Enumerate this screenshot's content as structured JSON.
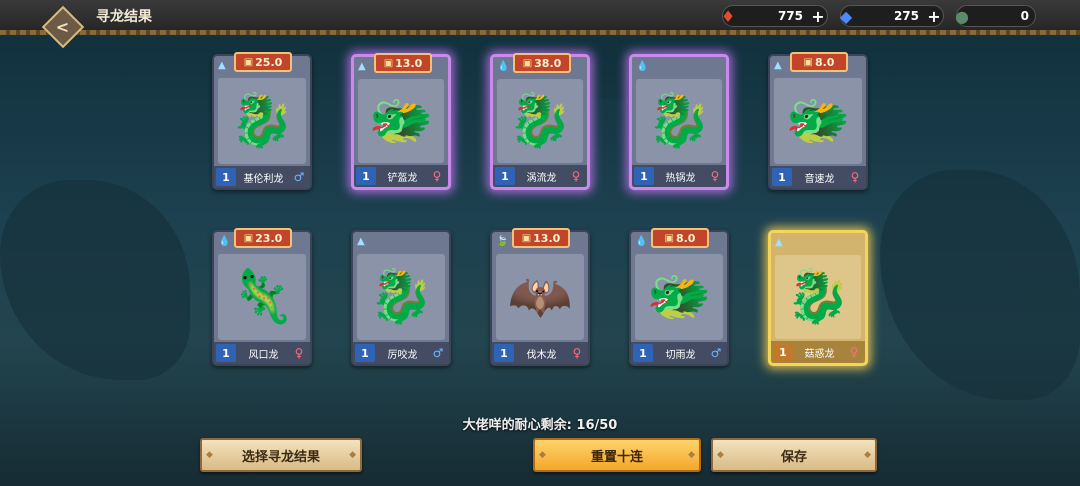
{
  "header": {
    "back_icon": "back-arrow-icon",
    "title": "寻龙结果",
    "resources": [
      {
        "icon": "red-gem-icon",
        "glyph": "♦",
        "color": "#e64a2e",
        "value": "775",
        "plus": "+"
      },
      {
        "icon": "blue-crystal-icon",
        "glyph": "◆",
        "color": "#4a8cff",
        "value": "275",
        "plus": "+"
      },
      {
        "icon": "dragon-egg-icon",
        "glyph": "●",
        "color": "#5a8a6a",
        "value": "0"
      }
    ]
  },
  "cards": [
    {
      "level": "1",
      "name": "基伦利龙",
      "sex": "♂",
      "sex_class": "m",
      "badge": "25.0",
      "badge_icon": "flame-box-icon",
      "element": "▲",
      "rarity": "normal",
      "glyph": "🐉"
    },
    {
      "level": "1",
      "name": "铲盔龙",
      "sex": "♀",
      "sex_class": "f",
      "badge": "13.0",
      "badge_icon": "axe-icon",
      "element": "▲",
      "rarity": "purple",
      "glyph": "🐲"
    },
    {
      "level": "1",
      "name": "涡流龙",
      "sex": "♀",
      "sex_class": "f",
      "badge": "38.0",
      "badge_icon": "flame-box-icon",
      "element": "💧",
      "rarity": "purple",
      "glyph": "🐉"
    },
    {
      "level": "1",
      "name": "热锅龙",
      "sex": "♀",
      "sex_class": "f",
      "badge": "",
      "badge_icon": "",
      "element": "💧",
      "rarity": "purple",
      "glyph": "🐉"
    },
    {
      "level": "1",
      "name": "音速龙",
      "sex": "♀",
      "sex_class": "f",
      "badge": "8.0",
      "badge_icon": "coin-icon",
      "element": "▲",
      "rarity": "normal",
      "glyph": "🐲"
    },
    {
      "level": "1",
      "name": "风口龙",
      "sex": "♀",
      "sex_class": "f",
      "badge": "23.0",
      "badge_icon": "flame-box-icon",
      "element": "💧",
      "rarity": "normal",
      "glyph": "🦎"
    },
    {
      "level": "1",
      "name": "厉咬龙",
      "sex": "♂",
      "sex_class": "m",
      "badge": "",
      "badge_icon": "",
      "element": "▲",
      "rarity": "normal",
      "glyph": "🐉"
    },
    {
      "level": "1",
      "name": "伐木龙",
      "sex": "♀",
      "sex_class": "f",
      "badge": "13.0",
      "badge_icon": "axe-icon",
      "element": "🍃",
      "rarity": "normal",
      "glyph": "🦇"
    },
    {
      "level": "1",
      "name": "切雨龙",
      "sex": "♂",
      "sex_class": "m",
      "badge": "8.0",
      "badge_icon": "coin-icon",
      "element": "💧",
      "rarity": "normal",
      "glyph": "🐲"
    },
    {
      "level": "1",
      "name": "菇惑龙",
      "sex": "♀",
      "sex_class": "f",
      "badge": "",
      "badge_icon": "",
      "element": "▲",
      "rarity": "gold",
      "glyph": "🐉"
    }
  ],
  "patience_text": "大佬咩的耐心剩余: 16/50",
  "buttons": {
    "select": "选择寻龙结果",
    "reset": "重置十连",
    "save": "保存"
  }
}
